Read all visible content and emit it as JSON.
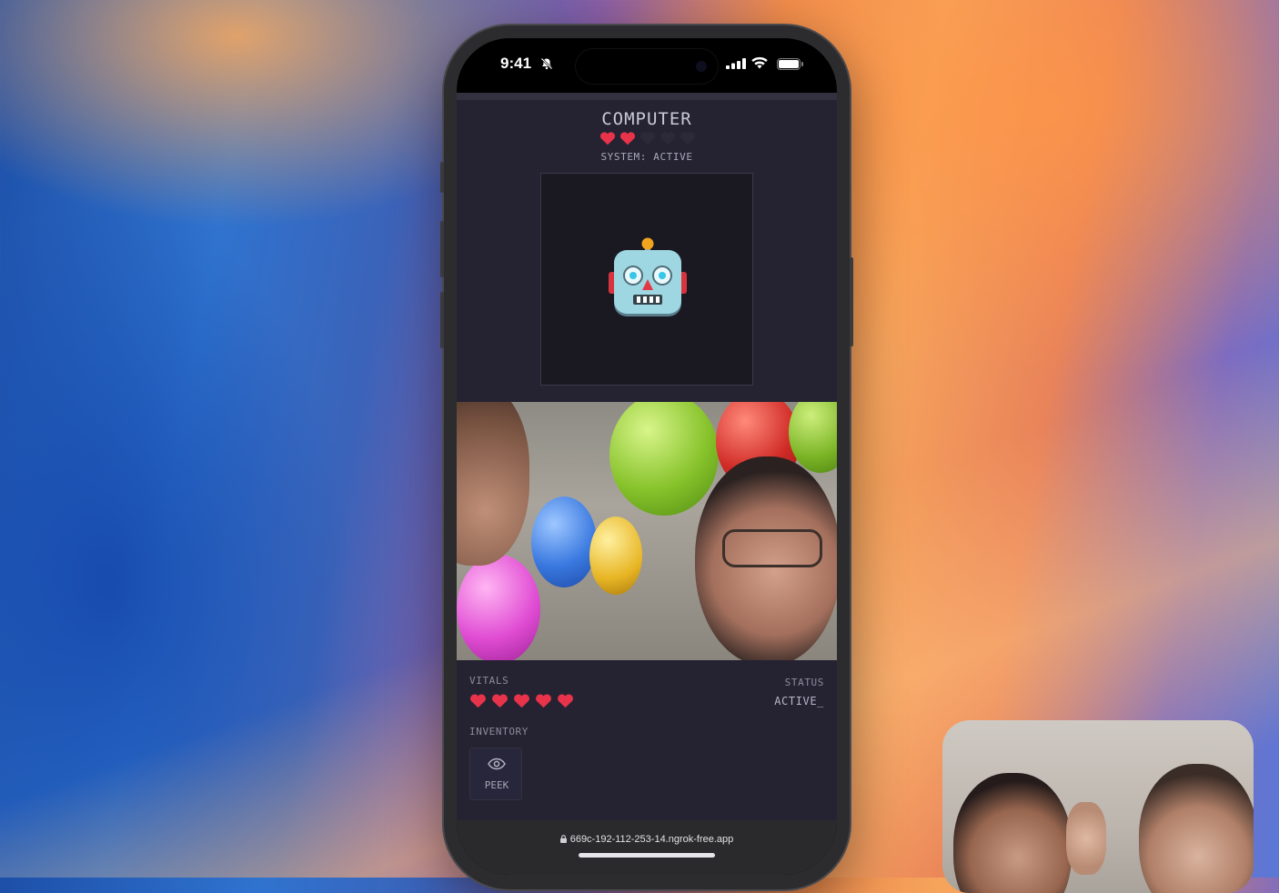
{
  "status_bar": {
    "time": "9:41",
    "icons": [
      "bell-slash-icon",
      "signal-icon",
      "wifi-icon",
      "battery-icon"
    ]
  },
  "game": {
    "opponent": {
      "name": "COMPUTER",
      "hearts_filled": 2,
      "hearts_total": 5,
      "system_status": "SYSTEM: ACTIVE",
      "avatar_icon": "robot-face-icon"
    },
    "camera_feed": {
      "description_icon": "live-camera-feed"
    },
    "player": {
      "vitals_label": "VITALS",
      "hearts_filled": 5,
      "status_label": "STATUS",
      "status_value": "ACTIVE_",
      "inventory_label": "INVENTORY",
      "inventory": [
        {
          "label": "PEEK",
          "icon": "eye-icon"
        }
      ]
    }
  },
  "browser": {
    "url": "669c-192-112-253-14.ngrok-free.app",
    "lock_icon": "lock-icon"
  },
  "colors": {
    "heart": "#e8334a",
    "app_bg": "#252332",
    "panel_bg": "#1a1922"
  }
}
